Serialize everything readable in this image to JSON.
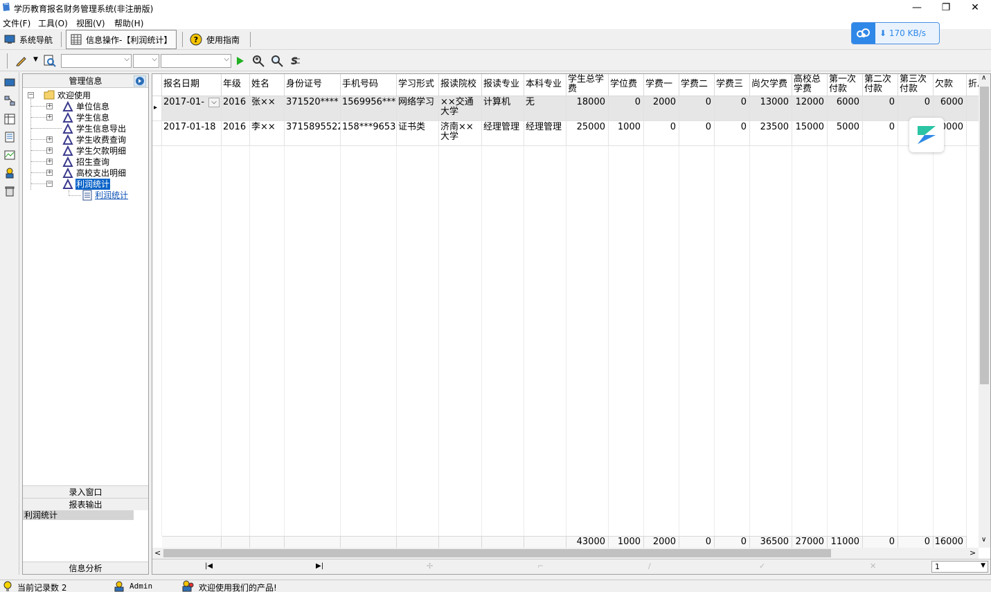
{
  "window": {
    "title": "学历教育报名财务管理系统(非注册版)",
    "minimize": "—",
    "restore": "❐",
    "close": "✕"
  },
  "menu": [
    "文件(F)",
    "工具(O)",
    "视图(V)",
    "帮助(H)"
  ],
  "nav": {
    "system_nav": "系统导航",
    "info_ops": "信息操作-【利润统计】",
    "guide": "使用指南"
  },
  "speed_widget": {
    "value": "170 KB/s"
  },
  "toolbar": {
    "page_select_value": "1"
  },
  "left_panel": {
    "header": "管理信息",
    "tree": {
      "root": "欢迎使用",
      "items": [
        "单位信息",
        "学生信息",
        "学生信息导出",
        "学生收费查询",
        "学生欠款明细",
        "招生查询",
        "高校支出明细",
        "利润统计"
      ],
      "child": "利润统计"
    },
    "buttons": [
      "录入窗口",
      "报表输出"
    ],
    "selected_item": "利润统计",
    "footer_button": "信息分析"
  },
  "grid": {
    "columns": [
      "报名日期",
      "年级",
      "姓名",
      "身份证号",
      "手机号码",
      "学习形式",
      "报读院校",
      "报读专业",
      "本科专业",
      "学生总学费",
      "学位费",
      "学费一",
      "学费二",
      "学费三",
      "尚欠学费",
      "高校总学费",
      "第一次付款",
      "第二次付款",
      "第三次付款",
      "欠款",
      "折总"
    ],
    "rows": [
      [
        "2017-01-",
        "2016",
        "张××",
        "371520****",
        "1569956***",
        "网络学习",
        "××交通大学",
        "计算机",
        "无",
        "18000",
        "0",
        "2000",
        "0",
        "0",
        "13000",
        "12000",
        "6000",
        "0",
        "0",
        "6000",
        ""
      ],
      [
        "2017-01-18",
        "2016",
        "李××",
        "3715895522",
        "158***9653",
        "证书类",
        "济南××大学",
        "经理管理",
        "经理管理",
        "25000",
        "1000",
        "0",
        "0",
        "0",
        "23500",
        "15000",
        "5000",
        "0",
        "",
        "0000",
        ""
      ]
    ],
    "totals": [
      "43000",
      "1000",
      "2000",
      "0",
      "0",
      "36500",
      "27000",
      "11000",
      "0",
      "0",
      "16000"
    ]
  },
  "statusbar": {
    "record_count": "当前记录数 2",
    "user": "Admin",
    "welcome": "欢迎使用我们的产品!"
  }
}
